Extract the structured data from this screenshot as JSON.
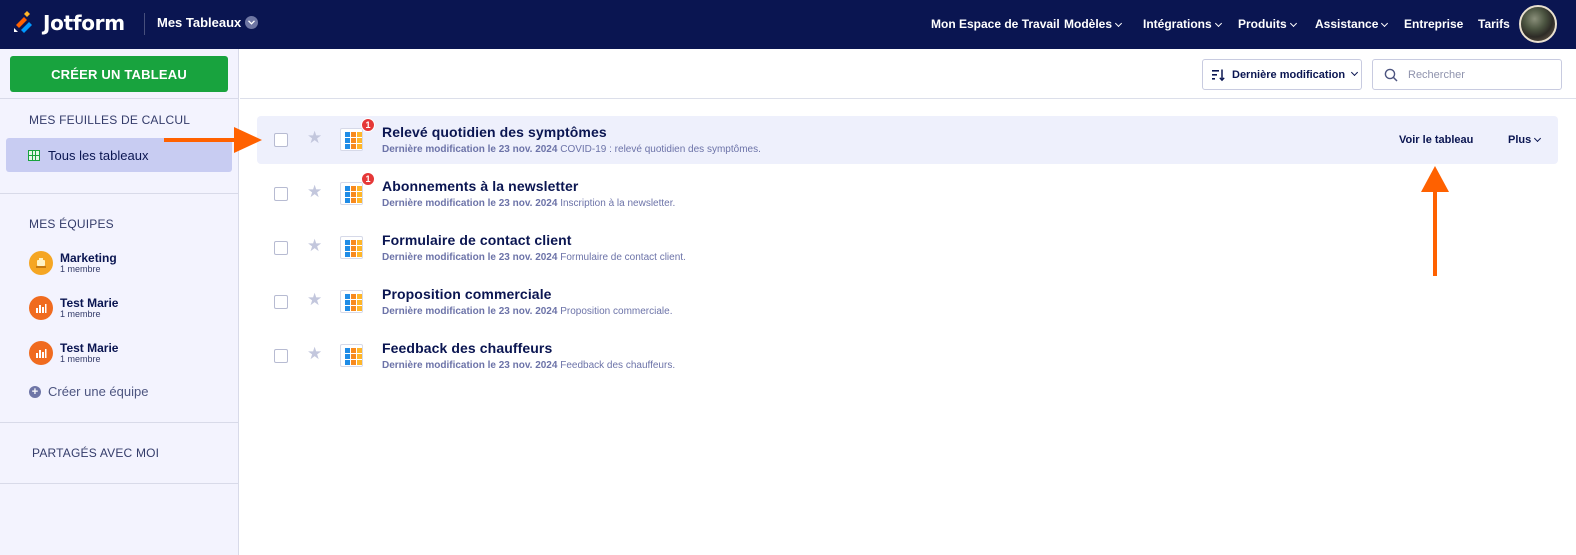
{
  "header": {
    "brand": "Jotform",
    "workspace_label": "Mes Tableaux",
    "nav": [
      {
        "label": "Mon Espace de Travail",
        "has_caret": false
      },
      {
        "label": "Modèles",
        "has_caret": true
      },
      {
        "label": "Intégrations",
        "has_caret": true
      },
      {
        "label": "Produits",
        "has_caret": true
      },
      {
        "label": "Assistance",
        "has_caret": true
      },
      {
        "label": "Entreprise",
        "has_caret": false
      },
      {
        "label": "Tarifs",
        "has_caret": false
      }
    ]
  },
  "sidebar": {
    "create_button": "CRÉER UN TABLEAU",
    "sheets_heading": "MES FEUILLES DE CALCUL",
    "all_tables": "Tous les tableaux",
    "teams_heading": "MES ÉQUIPES",
    "teams": [
      {
        "name": "Marketing",
        "members": "1 membre",
        "color": "#f5a623"
      },
      {
        "name": "Test Marie",
        "members": "1 membre",
        "color": "#f06b1f"
      },
      {
        "name": "Test Marie",
        "members": "1 membre",
        "color": "#f06b1f"
      }
    ],
    "create_team": "Créer une équipe",
    "shared_heading": "PARTAGÉS AVEC MOI"
  },
  "toolbar": {
    "sort_label": "Dernière modification",
    "search_placeholder": "Rechercher"
  },
  "tables": [
    {
      "title": "Relevé quotidien des symptômes",
      "modified": "Dernière modification le 23 nov. 2024",
      "description": "COVID-19 : relevé quotidien des symptômes.",
      "badge": "1",
      "view_label": "Voir le tableau",
      "more_label": "Plus"
    },
    {
      "title": "Abonnements à la newsletter",
      "modified": "Dernière modification le 23 nov. 2024",
      "description": "Inscription à la newsletter.",
      "badge": "1"
    },
    {
      "title": "Formulaire de contact client",
      "modified": "Dernière modification le 23 nov. 2024",
      "description": "Formulaire de contact client.",
      "badge": ""
    },
    {
      "title": "Proposition commerciale",
      "modified": "Dernière modification le 23 nov. 2024",
      "description": "Proposition commerciale.",
      "badge": ""
    },
    {
      "title": "Feedback des chauffeurs",
      "modified": "Dernière modification le 23 nov. 2024",
      "description": "Feedback des chauffeurs.",
      "badge": ""
    }
  ],
  "colors": {
    "nav_bg": "#0a1551",
    "create_button": "#18a33e",
    "sidebar_bg": "#f3f3fe",
    "selected_item": "#c8ccf2",
    "annotation_arrow": "#ff6100",
    "badge": "#e53838"
  }
}
